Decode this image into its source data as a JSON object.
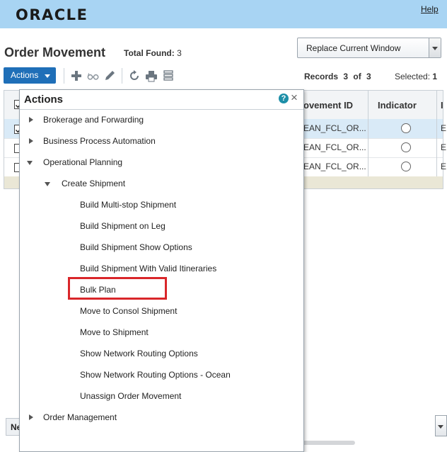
{
  "header": {
    "logo_text": "ORACLE",
    "help_link": "Help"
  },
  "page": {
    "title": "Order Movement",
    "total_found_label": "Total Found:",
    "total_found_value": "3",
    "window_select": {
      "selected": "Replace Current Window"
    },
    "actions_button": "Actions",
    "records_text": "Records 3 of 3",
    "selected_label": "Selected:",
    "selected_value": "1"
  },
  "toolbar_icons": [
    "add-icon",
    "glasses-icon",
    "edit-icon",
    "refresh-icon",
    "print-icon",
    "list-icon"
  ],
  "grid": {
    "columns": [
      {
        "label": "ovement ID"
      },
      {
        "label": "Indicator"
      },
      {
        "label": "I"
      }
    ],
    "rows": [
      {
        "selected": true,
        "movement_id": "EAN_FCL_OR...",
        "last": "E"
      },
      {
        "selected": false,
        "movement_id": "EAN_FCL_OR...",
        "last": "E"
      },
      {
        "selected": false,
        "movement_id": "EAN_FCL_OR...",
        "last": "E"
      }
    ]
  },
  "bottom_bar": {
    "label": "Ne"
  },
  "actions_panel": {
    "title": "Actions",
    "help_icon": "?",
    "close_icon": "×",
    "items": [
      {
        "label": "Brokerage and Forwarding",
        "level": 0,
        "state": "collapsed"
      },
      {
        "label": "Business Process Automation",
        "level": 0,
        "state": "collapsed"
      },
      {
        "label": "Operational Planning",
        "level": 0,
        "state": "expanded"
      },
      {
        "label": "Create Shipment",
        "level": 1,
        "state": "expanded"
      },
      {
        "label": "Build Multi-stop Shipment",
        "level": 2,
        "state": "leaf"
      },
      {
        "label": "Build Shipment on Leg",
        "level": 2,
        "state": "leaf"
      },
      {
        "label": "Build Shipment Show Options",
        "level": 2,
        "state": "leaf"
      },
      {
        "label": "Build Shipment With Valid Itineraries",
        "level": 2,
        "state": "leaf"
      },
      {
        "label": "Bulk Plan",
        "level": 2,
        "state": "leaf",
        "highlighted": true
      },
      {
        "label": "Move to Consol Shipment",
        "level": 2,
        "state": "leaf"
      },
      {
        "label": "Move to Shipment",
        "level": 2,
        "state": "leaf"
      },
      {
        "label": "Show Network Routing Options",
        "level": 2,
        "state": "leaf"
      },
      {
        "label": "Show Network Routing Options - Ocean",
        "level": 2,
        "state": "leaf"
      },
      {
        "label": "Unassign Order Movement",
        "level": 2,
        "state": "leaf"
      },
      {
        "label": "Order Management",
        "level": 0,
        "state": "collapsed"
      }
    ]
  },
  "colors": {
    "header_bg": "#a8d4f3",
    "actions_button_bg": "#1f6fb8",
    "highlight_border": "#d9262a",
    "selected_row_bg": "#d9eaf7"
  }
}
